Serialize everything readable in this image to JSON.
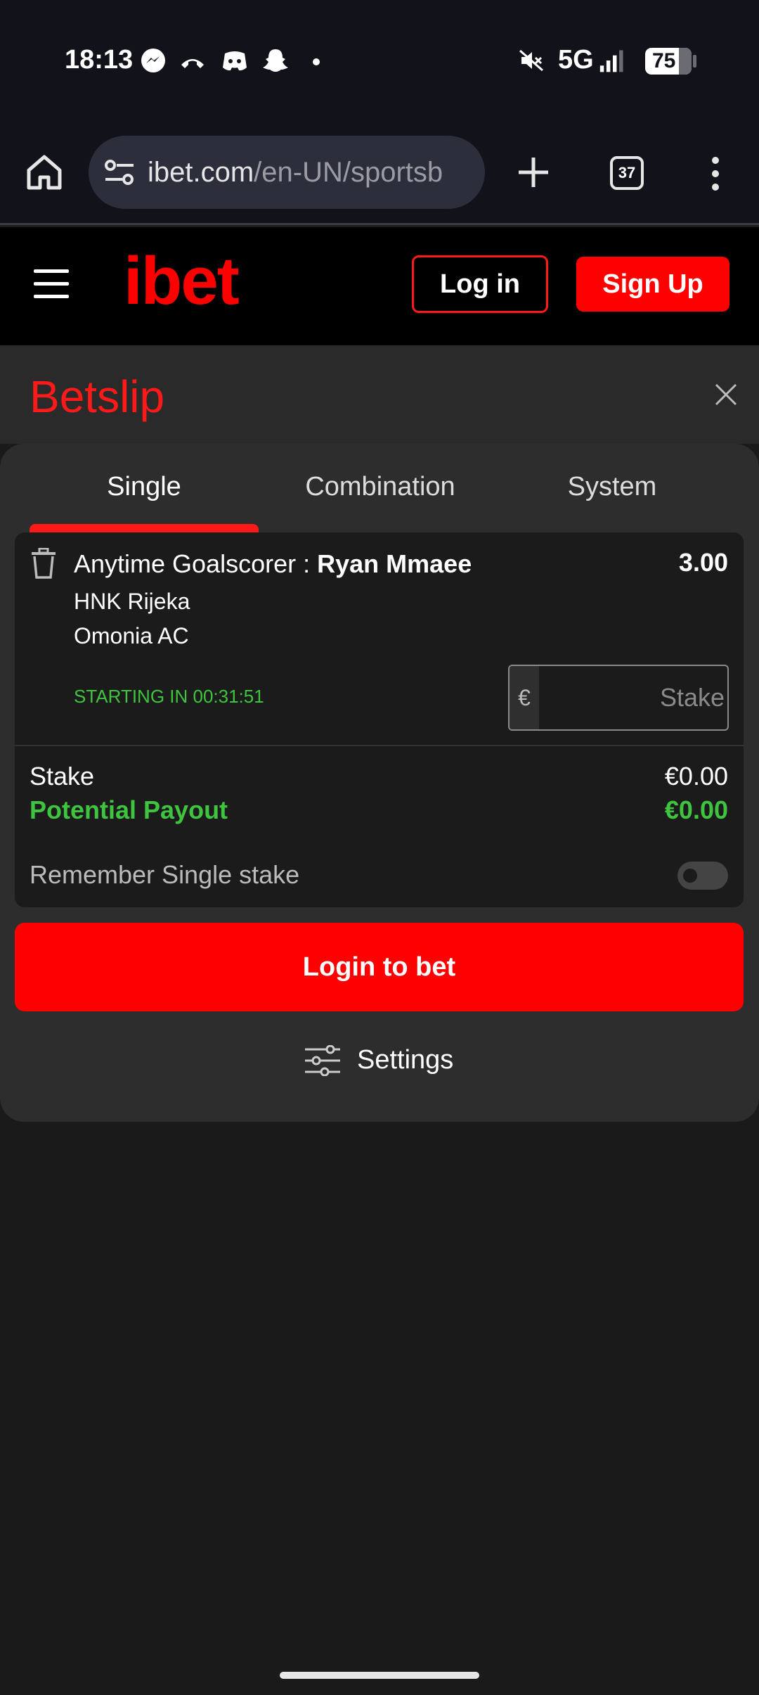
{
  "status_bar": {
    "time": "18:13",
    "network": "5G",
    "battery": "75"
  },
  "browser": {
    "url_host": "ibet.com",
    "url_path": "/en-UN/sportsb",
    "tab_count": "37"
  },
  "site_nav": {
    "logo": "ibet",
    "login_label": "Log in",
    "signup_label": "Sign Up"
  },
  "betslip": {
    "title": "Betslip",
    "tabs": [
      {
        "label": "Single",
        "active": true
      },
      {
        "label": "Combination",
        "active": false
      },
      {
        "label": "System",
        "active": false
      }
    ],
    "selection": {
      "market": "Anytime Goalscorer : ",
      "player": "Ryan Mmaee",
      "odds": "3.00",
      "team_home": "HNK Rijeka",
      "team_away": "Omonia AC",
      "starting_in": "STARTING IN 00:31:51",
      "currency_symbol": "€",
      "stake_placeholder": "Stake"
    },
    "summary": {
      "stake_label": "Stake",
      "stake_value": "€0.00",
      "payout_label": "Potential Payout",
      "payout_value": "€0.00",
      "remember_label": "Remember Single stake",
      "remember_enabled": false
    },
    "login_button": "Login to bet",
    "settings_label": "Settings"
  },
  "colors": {
    "brand_red": "#ff0000",
    "positive_green": "#3ec43e",
    "background": "#1a1a1a",
    "panel": "#2d2d2d"
  }
}
